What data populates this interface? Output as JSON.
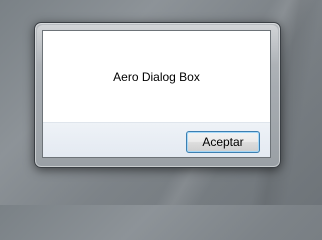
{
  "dialog": {
    "message": "Aero Dialog Box",
    "accept_button_label": "Aceptar"
  }
}
